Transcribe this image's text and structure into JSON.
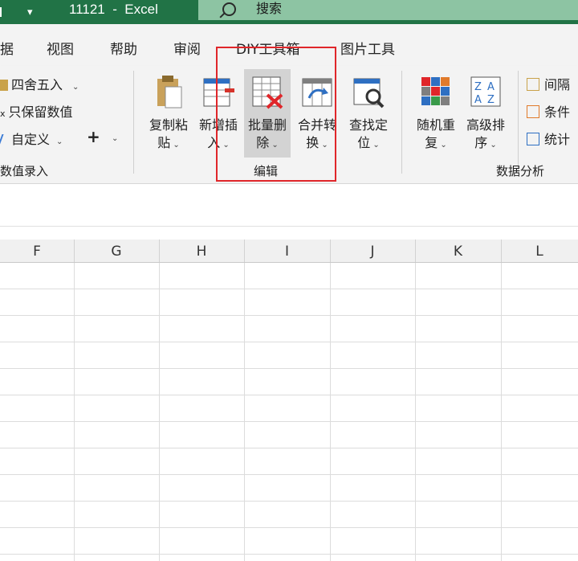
{
  "window": {
    "title": "11121  -  Excel"
  },
  "search": {
    "label": "搜索"
  },
  "tabs": [
    "据",
    "视图",
    "帮助",
    "审阅",
    "DIY工具箱",
    "图片工具"
  ],
  "ribbon": {
    "left_group": {
      "items": [
        "四舍五入",
        "只保留数值",
        "自定义"
      ],
      "group_label": "数值录入"
    },
    "edit_group": {
      "buttons": [
        {
          "line1": "复制粘",
          "line2": "贴"
        },
        {
          "line1": "新增插",
          "line2": "入"
        },
        {
          "line1": "批量删",
          "line2": "除"
        },
        {
          "line1": "合并转",
          "line2": "换"
        },
        {
          "line1": "查找定",
          "line2": "位"
        }
      ],
      "group_label": "编辑"
    },
    "analysis_group": {
      "buttons": [
        {
          "line1": "随机重",
          "line2": "复"
        },
        {
          "line1": "高级排",
          "line2": "序"
        }
      ],
      "small_items": [
        "间隔",
        "条件",
        "统计"
      ],
      "group_label": "数据分析"
    }
  },
  "columns": [
    "F",
    "G",
    "H",
    "I",
    "J",
    "K",
    "L"
  ],
  "colors": {
    "title_green": "#217346",
    "highlight_red": "#e0262a"
  }
}
